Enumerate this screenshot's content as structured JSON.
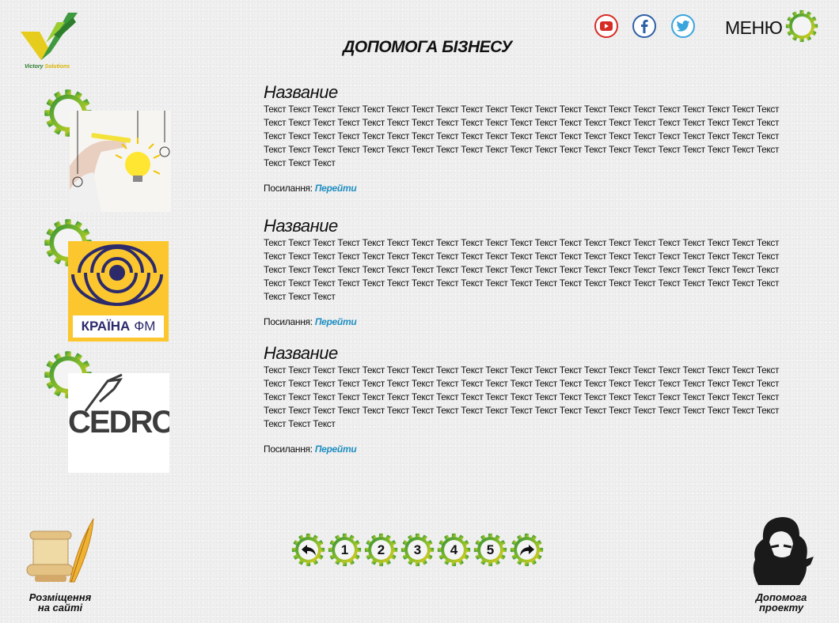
{
  "header": {
    "logo_text_a": "Victory ",
    "logo_text_b": "Solutions",
    "page_title": "ДОПОМОГА БІЗНЕСУ",
    "social": [
      "youtube-icon",
      "facebook-icon",
      "twitter-icon"
    ],
    "menu_label": "МЕНЮ"
  },
  "colors": {
    "gear_green": "#3f9a3f",
    "gear_yellow": "#e2c820",
    "link_blue": "#1f8ec2",
    "youtube_red": "#d62c25",
    "facebook_blue": "#2f5fa7",
    "twitter_blue": "#3aa5dc"
  },
  "entries": [
    {
      "title": "Название",
      "body": "Текст Текст Текст Текст Текст Текст Текст Текст Текст Текст Текст Текст Текст Текст Текст Текст Текст Текст Текст Текст Текст Текст Текст Текст Текст Текст Текст Текст Текст Текст Текст Текст Текст Текст Текст Текст Текст Текст Текст Текст Текст Текст Текст Текст Текст Текст Текст Текст Текст Текст Текст Текст Текст Текст Текст Текст Текст Текст Текст Текст Текст Текст Текст Текст Текст Текст Текст Текст Текст Текст Текст Текст Текст Текст Текст Текст Текст Текст Текст Текст Текст Текст Текст Текст Текст Текст Текст",
      "link_label": "Посилання: ",
      "link_text": "Перейти",
      "image": "lightbulb-photo"
    },
    {
      "title": "Название",
      "body": "Текст Текст Текст Текст Текст Текст Текст Текст Текст Текст Текст Текст Текст Текст Текст Текст Текст Текст Текст Текст Текст Текст Текст Текст Текст Текст Текст Текст Текст Текст Текст Текст Текст Текст Текст Текст Текст Текст Текст Текст Текст Текст Текст Текст Текст Текст Текст Текст Текст Текст Текст Текст Текст Текст Текст Текст Текст Текст Текст Текст Текст Текст Текст Текст Текст Текст Текст Текст Текст Текст Текст Текст Текст Текст Текст Текст Текст Текст Текст Текст Текст Текст Текст Текст Текст Текст Текст",
      "link_label": "Посилання: ",
      "link_text": "Перейти",
      "image": "kraina-fm-logo",
      "image_text_a": "КРАЇНА",
      "image_text_b": "ФМ"
    },
    {
      "title": "Название",
      "body": "Текст Текст Текст Текст Текст Текст Текст Текст Текст Текст Текст Текст Текст Текст Текст Текст Текст Текст Текст Текст Текст Текст Текст Текст Текст Текст Текст Текст Текст Текст Текст Текст Текст Текст Текст Текст Текст Текст Текст Текст Текст Текст Текст Текст Текст Текст Текст Текст Текст Текст Текст Текст Текст Текст Текст Текст Текст Текст Текст Текст Текст Текст Текст Текст Текст Текст Текст Текст Текст Текст Текст Текст Текст Текст Текст Текст Текст Текст Текст Текст Текст Текст Текст Текст Текст Текст Текст",
      "link_label": "Посилання: ",
      "link_text": "Перейти",
      "image": "cedro-logo",
      "image_text": "CEDRO"
    }
  ],
  "pager": {
    "prev_icon": "arrow-back-icon",
    "pages": [
      "1",
      "2",
      "3",
      "4",
      "5"
    ],
    "next_icon": "arrow-forward-icon"
  },
  "footer": {
    "left_label_1": "Розміщення",
    "left_label_2": "на сайті",
    "left_icon": "scroll-quill-icon",
    "right_label_1": "Допомога",
    "right_label_2": "проекту",
    "right_icon": "bearded-man-portrait-icon"
  }
}
